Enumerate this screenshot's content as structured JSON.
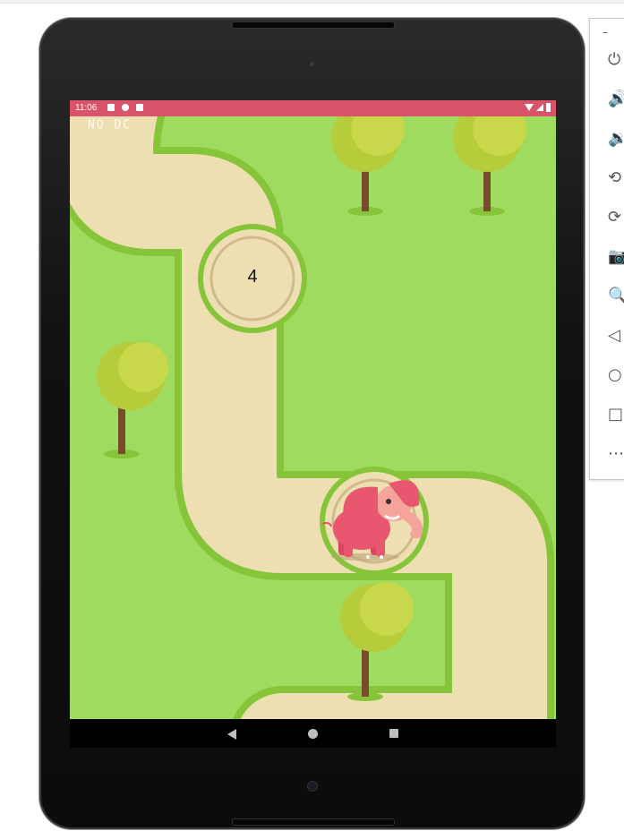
{
  "status_bar": {
    "time": "11:06"
  },
  "game": {
    "debug_text": "NO DC",
    "waypoint_number": "4"
  },
  "colors": {
    "status_bar": "#d9536a",
    "grass": "#9edb5f",
    "path": "#eedfb3",
    "path_border": "#86c43a",
    "elephant": "#e8576f"
  },
  "nav_bar": {
    "icons": [
      "back-icon",
      "home-icon",
      "recents-icon"
    ]
  },
  "emulator_toolbar": {
    "minimize_label": "–",
    "items": [
      {
        "name": "power-icon",
        "glyph": "⏻"
      },
      {
        "name": "volume-up-icon",
        "glyph": "🔊"
      },
      {
        "name": "volume-down-icon",
        "glyph": "🔉"
      },
      {
        "name": "rotate-left-icon",
        "glyph": "⟲"
      },
      {
        "name": "rotate-right-icon",
        "glyph": "⟳"
      },
      {
        "name": "camera-icon",
        "glyph": "📷"
      },
      {
        "name": "zoom-icon",
        "glyph": "🔍"
      },
      {
        "name": "back-icon",
        "glyph": "◁"
      },
      {
        "name": "home-icon",
        "glyph": "○"
      },
      {
        "name": "overview-icon",
        "glyph": "□"
      },
      {
        "name": "more-icon",
        "glyph": "⋯"
      }
    ]
  }
}
